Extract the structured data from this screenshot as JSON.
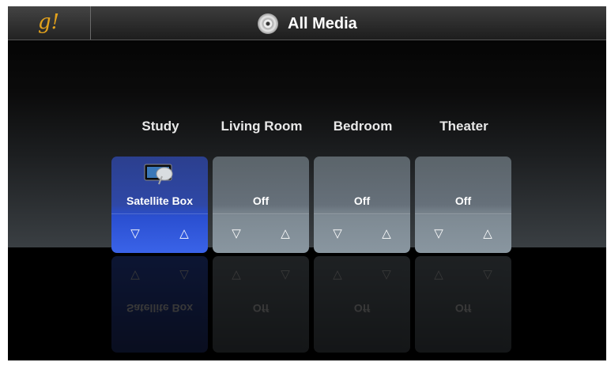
{
  "header": {
    "logo": "g!",
    "title": "All Media",
    "title_icon": "disc-icon"
  },
  "zones": [
    {
      "label": "Study",
      "source": "Satellite Box",
      "state": "active",
      "down": "▽",
      "up": "△"
    },
    {
      "label": "Living Room",
      "source": "Off",
      "state": "off",
      "down": "▽",
      "up": "△"
    },
    {
      "label": "Bedroom",
      "source": "Off",
      "state": "off",
      "down": "▽",
      "up": "△"
    },
    {
      "label": "Theater",
      "source": "Off",
      "state": "off",
      "down": "▽",
      "up": "△"
    }
  ],
  "colors": {
    "active": "#2f48a6",
    "off": "#6a757e",
    "logo": "#e3a21c"
  }
}
